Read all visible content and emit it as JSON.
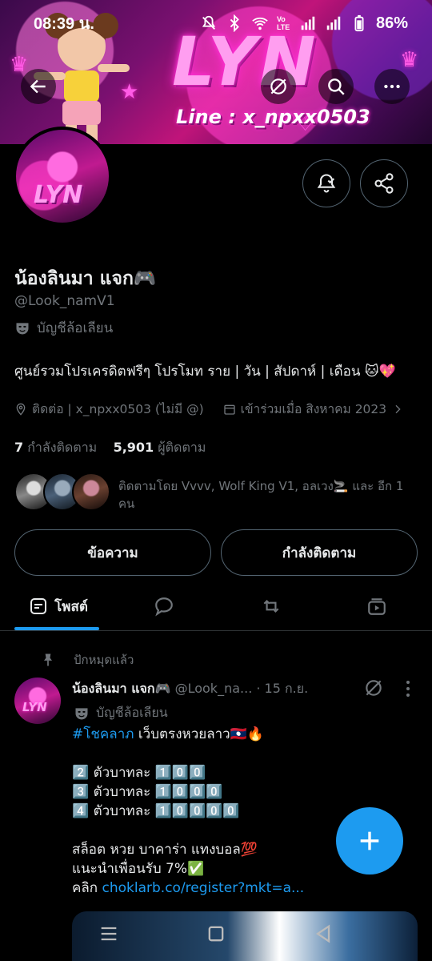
{
  "status_bar": {
    "time": "08:39 น.",
    "battery": "86%",
    "icons": [
      "mute-icon",
      "bluetooth-icon",
      "wifi-icon",
      "volte-icon",
      "signal-icon",
      "signal-icon",
      "battery-icon"
    ],
    "volte_label": "Vo LTE"
  },
  "banner": {
    "logo": "LYN",
    "line_text": "Line : x_npxx0503"
  },
  "top_nav": {
    "icons": [
      "back-arrow-icon",
      "grok-icon",
      "search-icon",
      "more-icon"
    ]
  },
  "profile": {
    "avatar_text": "LYN",
    "name": "น้องลินมา แจก🎮",
    "handle": "@Look_namV1",
    "parody_label": "บัญชีล้อเลียน",
    "bio": "ศูนย์รวมโปรเครดิตฟรีๆ โปรโมท ราย | วัน | สัปดาห์ | เดือน 🐱💖",
    "location": "ติดต่อ | x_npxx0503 (ไม่มี @)",
    "joined": "เข้าร่วมเมื่อ สิงหาคม 2023",
    "following_count": "7",
    "following_label": "กำลังติดตาม",
    "followers_count": "5,901",
    "followers_label": "ผู้ติดตาม",
    "followed_by": "ติดตามโดย Vvvv, Wolf King V1, อลเวง🚬 และ อีก 1 คน"
  },
  "actions": {
    "message": "ข้อความ",
    "following": "กำลังติดตาม"
  },
  "tabs": {
    "posts": "โพสต์"
  },
  "post": {
    "pinned_label": "ปักหมุดแล้ว",
    "author_name": "น้องลินมา แจก🎮",
    "author_handle": "@Look_na...",
    "date": "· 15 ก.ย.",
    "parody_label": "บัญชีล้อเลียน",
    "hashtag": "#โชคลาภ",
    "line1_rest": " เว็บตรงหวยลาว🇱🇦🔥",
    "line2": "2️⃣ ตัวบาทละ 1️⃣0️⃣0️⃣",
    "line3": "3️⃣ ตัวบาทละ 1️⃣0️⃣0️⃣0️⃣",
    "line4": "4️⃣ ตัวบาทละ 1️⃣0️⃣0️⃣0️⃣0️⃣",
    "line5": "สล็อต หวย บาคาร่า แทงบอล💯",
    "line6": "แนะนำเพื่อนรับ 7%✅",
    "line7_prefix": "คลิก ",
    "link": "choklarb.co/register?mkt=a..."
  },
  "colors": {
    "accent": "#1d9bf0",
    "muted": "#71767b",
    "border": "#536471",
    "text": "#e7e9ea",
    "background": "#000000"
  }
}
